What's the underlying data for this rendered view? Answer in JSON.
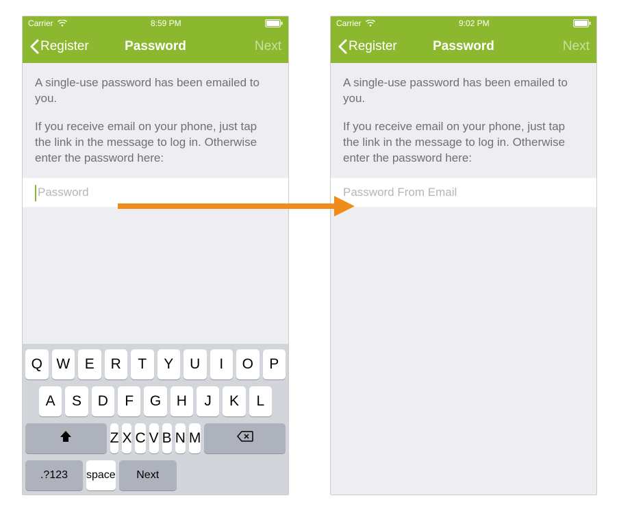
{
  "colors": {
    "accent": "#8cb82f",
    "arrow": "#f08c1a",
    "text_muted": "#6f6f74",
    "placeholder": "#b5b5b9"
  },
  "left": {
    "status": {
      "carrier": "Carrier",
      "time": "8:59 PM"
    },
    "nav": {
      "back": "Register",
      "title": "Password",
      "next": "Next"
    },
    "instructions": {
      "p1": "A single-use password has been emailed to you.",
      "p2": "If you receive email on your phone, just tap the link in the message to log in. Otherwise enter the password here:"
    },
    "input": {
      "placeholder": "Password",
      "value": ""
    },
    "keyboard": {
      "row1": [
        "Q",
        "W",
        "E",
        "R",
        "T",
        "Y",
        "U",
        "I",
        "O",
        "P"
      ],
      "row2": [
        "A",
        "S",
        "D",
        "F",
        "G",
        "H",
        "J",
        "K",
        "L"
      ],
      "row3": [
        "Z",
        "X",
        "C",
        "V",
        "B",
        "N",
        "M"
      ],
      "symbols": ".?123",
      "space": "space",
      "return": "Next"
    }
  },
  "right": {
    "status": {
      "carrier": "Carrier",
      "time": "9:02 PM"
    },
    "nav": {
      "back": "Register",
      "title": "Password",
      "next": "Next"
    },
    "instructions": {
      "p1": "A single-use password has been emailed to you.",
      "p2": "If you receive email on your phone, just tap the link in the message to log in. Otherwise enter the password here:"
    },
    "input": {
      "placeholder": "Password From Email",
      "value": ""
    }
  }
}
